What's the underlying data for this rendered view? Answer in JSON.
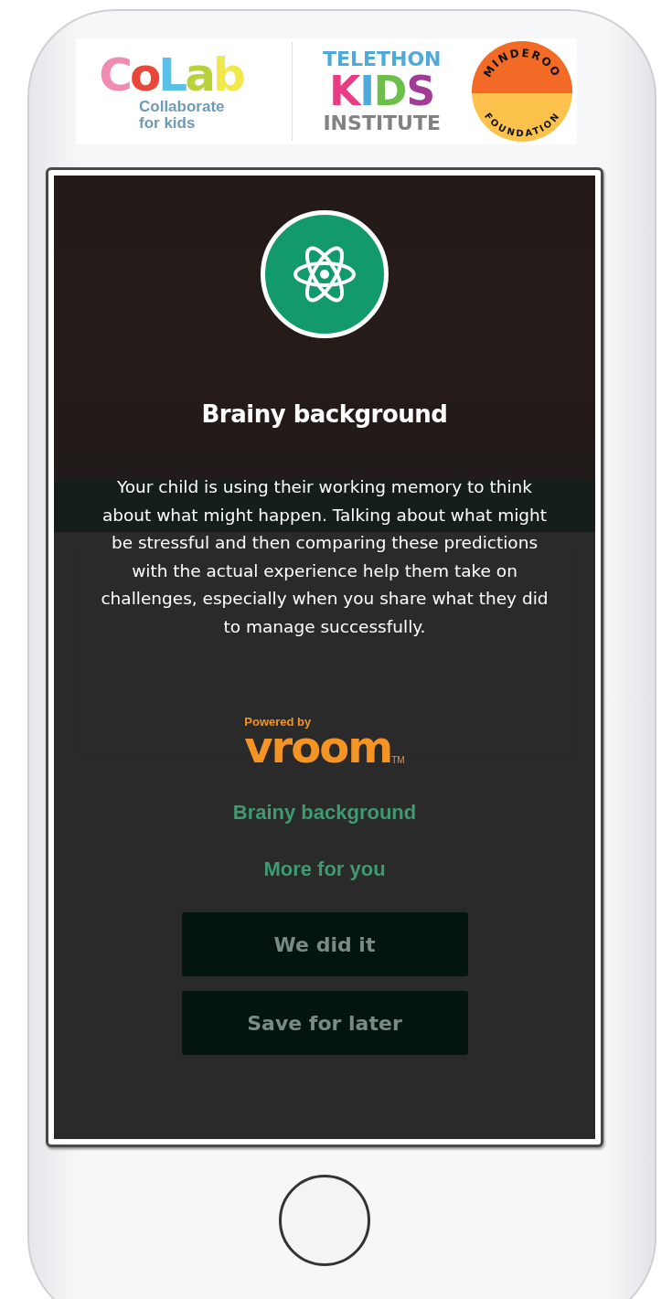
{
  "banner": {
    "colab": {
      "wordmark": "CoLab",
      "tagline": "Collaborate for kids"
    },
    "telethon": {
      "top": "TELETHON",
      "middle": "KIDS",
      "bottom": "INSTITUTE"
    },
    "minderoo": {
      "top": "MINDEROO",
      "bottom": "FOUNDATION"
    }
  },
  "screen": {
    "section_link": "Brainy background",
    "more_link": "More for you",
    "buttons": [
      "We did it",
      "Save for later"
    ]
  },
  "modal": {
    "title": "Brainy background",
    "body": "Your child is using their working memory to think about what might happen. Talking about what might be stressful and then comparing these predictions with the actual experience help them take on challenges, especially when you share what they did to manage successfully.",
    "powered_by": "Powered by",
    "brand": "vroom",
    "trademark": "TM"
  }
}
